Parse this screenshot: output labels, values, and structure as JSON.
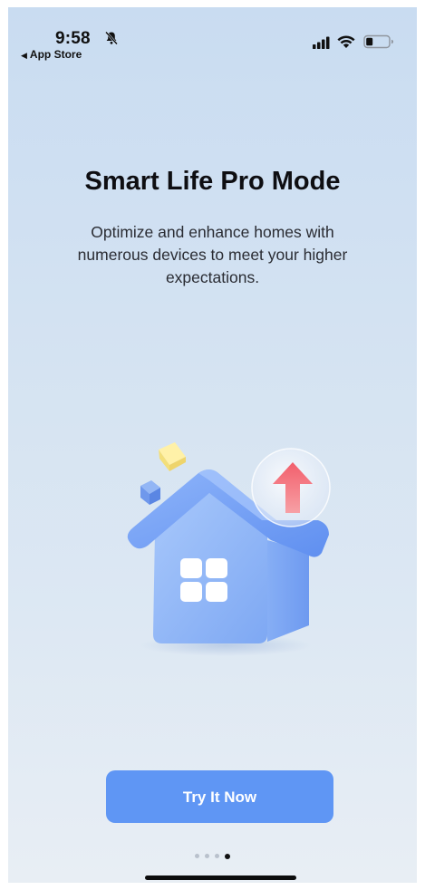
{
  "status_bar": {
    "time": "9:58",
    "back_label": "App Store",
    "icons": [
      "bell-slash-icon",
      "cellular-signal-icon",
      "wifi-icon",
      "battery-icon"
    ]
  },
  "onboarding": {
    "title": "Smart Life Pro Mode",
    "subtitle": "Optimize and enhance homes with numerous devices to meet your higher expectations.",
    "illustration_icons": [
      "house-icon",
      "upgrade-arrow-icon",
      "cube-icon"
    ],
    "cta_label": "Try It Now"
  },
  "pager": {
    "total_pages": 4,
    "active_page": 4
  },
  "colors": {
    "accent": "#5f96f4",
    "background_top": "#c9dcf1",
    "background_bottom": "#e8eef4",
    "arrow": "#f2767b"
  }
}
